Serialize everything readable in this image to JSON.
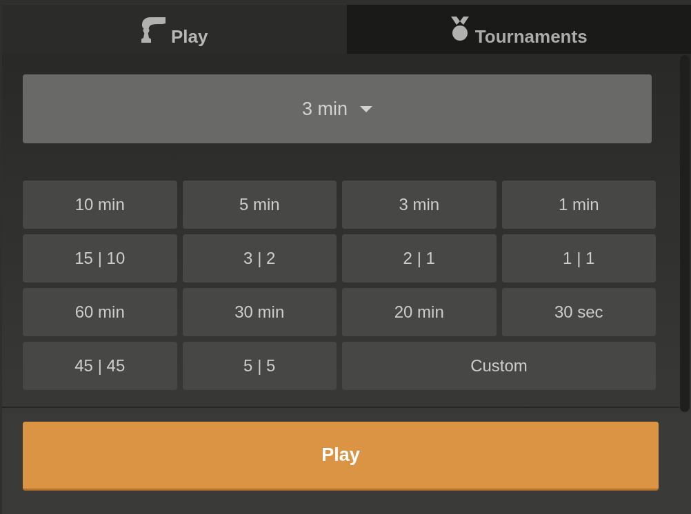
{
  "tabs": [
    {
      "label": "Play",
      "selected": true
    },
    {
      "label": "Tournaments",
      "selected": false
    }
  ],
  "time_control": {
    "value": "3 min"
  },
  "presets": [
    {
      "label": "10 min",
      "kind": "preset"
    },
    {
      "label": "5 min",
      "kind": "preset"
    },
    {
      "label": "3 min",
      "kind": "preset"
    },
    {
      "label": "1 min",
      "kind": "preset"
    },
    {
      "label": "15 | 10",
      "kind": "preset"
    },
    {
      "label": "3 | 2",
      "kind": "preset"
    },
    {
      "label": "2 | 1",
      "kind": "preset"
    },
    {
      "label": "1 | 1",
      "kind": "preset"
    },
    {
      "label": "60 min",
      "kind": "preset"
    },
    {
      "label": "30 min",
      "kind": "preset"
    },
    {
      "label": "20 min",
      "kind": "preset"
    },
    {
      "label": "30 sec",
      "kind": "preset"
    },
    {
      "label": "45 | 45",
      "kind": "preset"
    },
    {
      "label": "5 | 5",
      "kind": "preset"
    },
    {
      "label": "Custom",
      "kind": "custom"
    }
  ],
  "play_button": {
    "label": "Play"
  }
}
